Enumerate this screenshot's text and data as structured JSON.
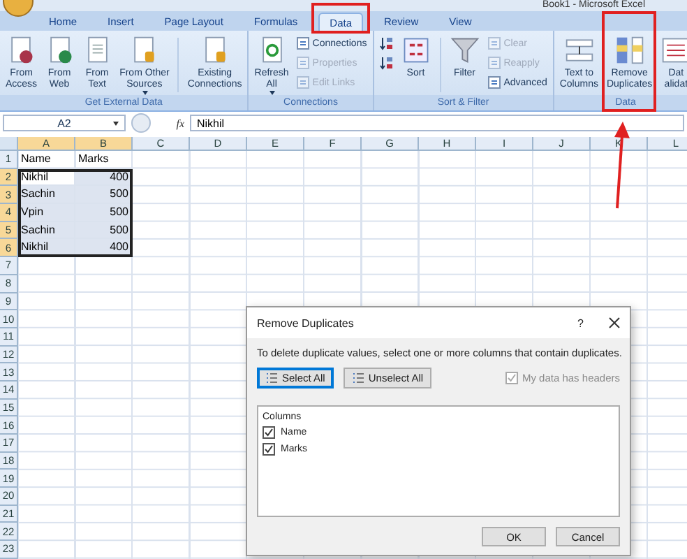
{
  "title": "Book1 - Microsoft Excel",
  "tabs": [
    {
      "label": "Home",
      "selected": false,
      "highlighted": false
    },
    {
      "label": "Insert",
      "selected": false,
      "highlighted": false
    },
    {
      "label": "Page Layout",
      "selected": false,
      "highlighted": false
    },
    {
      "label": "Formulas",
      "selected": false,
      "highlighted": false
    },
    {
      "label": "Data",
      "selected": true,
      "highlighted": true
    },
    {
      "label": "Review",
      "selected": false,
      "highlighted": false
    },
    {
      "label": "View",
      "selected": false,
      "highlighted": false
    }
  ],
  "ribbon_groups": [
    {
      "label": "Get External Data",
      "items": [
        {
          "kind": "large",
          "label": "From\nAccess",
          "dropdown": false,
          "highlighted": false
        },
        {
          "kind": "large",
          "label": "From\nWeb",
          "dropdown": false,
          "highlighted": false
        },
        {
          "kind": "large",
          "label": "From\nText",
          "dropdown": false,
          "highlighted": false
        },
        {
          "kind": "large",
          "label": "From Other\nSources",
          "dropdown": true,
          "highlighted": false
        },
        {
          "kind": "separator"
        },
        {
          "kind": "large",
          "label": "Existing\nConnections",
          "dropdown": false,
          "highlighted": false
        }
      ]
    },
    {
      "label": "Connections",
      "items": [
        {
          "kind": "large",
          "label": "Refresh\nAll",
          "dropdown": true,
          "highlighted": false
        },
        {
          "kind": "stack",
          "items": [
            {
              "kind": "small",
              "label": "Connections",
              "disabled": false
            },
            {
              "kind": "small",
              "label": "Properties",
              "disabled": true
            },
            {
              "kind": "small",
              "label": "Edit Links",
              "disabled": true
            }
          ]
        }
      ]
    },
    {
      "label": "Sort & Filter",
      "items": [
        {
          "kind": "stack",
          "items": [
            {
              "kind": "icon",
              "disabled": false
            },
            {
              "kind": "icon",
              "disabled": false
            }
          ]
        },
        {
          "kind": "large",
          "label": "Sort",
          "dropdown": false,
          "highlighted": false
        },
        {
          "kind": "separator"
        },
        {
          "kind": "large",
          "label": "Filter",
          "dropdown": false,
          "highlighted": false
        },
        {
          "kind": "stack",
          "items": [
            {
              "kind": "small",
              "label": "Clear",
              "disabled": true
            },
            {
              "kind": "small",
              "label": "Reapply",
              "disabled": true
            },
            {
              "kind": "small",
              "label": "Advanced",
              "disabled": false
            }
          ]
        }
      ]
    },
    {
      "label": "Data",
      "items": [
        {
          "kind": "large",
          "label": "Text to\nColumns",
          "dropdown": false,
          "highlighted": false
        },
        {
          "kind": "large",
          "label": "Remove\nDuplicates",
          "dropdown": false,
          "highlighted": true
        },
        {
          "kind": "large",
          "label": "Dat\nalidat",
          "dropdown": false,
          "highlighted": false
        }
      ]
    }
  ],
  "formula_bar": {
    "name_box": "A2",
    "function_label": "fx",
    "value": "Nikhil"
  },
  "columns": [
    {
      "label": "A",
      "selected": true
    },
    {
      "label": "B",
      "selected": true
    },
    {
      "label": "C",
      "selected": false
    },
    {
      "label": "D",
      "selected": false
    },
    {
      "label": "E",
      "selected": false
    },
    {
      "label": "F",
      "selected": false
    },
    {
      "label": "G",
      "selected": false
    },
    {
      "label": "H",
      "selected": false
    },
    {
      "label": "I",
      "selected": false
    },
    {
      "label": "J",
      "selected": false
    },
    {
      "label": "K",
      "selected": false
    },
    {
      "label": "L",
      "selected": false
    }
  ],
  "rows": [
    {
      "number": "1",
      "selected": false,
      "cells": [
        {
          "text": "Name",
          "kind": "text",
          "selected": false
        },
        {
          "text": "Marks",
          "kind": "text",
          "selected": false
        }
      ]
    },
    {
      "number": "2",
      "selected": true,
      "cells": [
        {
          "text": "Nikhil",
          "kind": "text",
          "selected": true
        },
        {
          "text": "400",
          "kind": "number",
          "selected": true
        }
      ]
    },
    {
      "number": "3",
      "selected": true,
      "cells": [
        {
          "text": "Sachin",
          "kind": "text",
          "selected": true
        },
        {
          "text": "500",
          "kind": "number",
          "selected": true
        }
      ]
    },
    {
      "number": "4",
      "selected": true,
      "cells": [
        {
          "text": "Vpin",
          "kind": "text",
          "selected": true
        },
        {
          "text": "500",
          "kind": "number",
          "selected": true
        }
      ]
    },
    {
      "number": "5",
      "selected": true,
      "cells": [
        {
          "text": "Sachin",
          "kind": "text",
          "selected": true
        },
        {
          "text": "500",
          "kind": "number",
          "selected": true
        }
      ]
    },
    {
      "number": "6",
      "selected": true,
      "cells": [
        {
          "text": "Nikhil",
          "kind": "text",
          "selected": true
        },
        {
          "text": "400",
          "kind": "number",
          "selected": true
        }
      ]
    },
    {
      "number": "7",
      "selected": false
    },
    {
      "number": "8",
      "selected": false
    },
    {
      "number": "9",
      "selected": false
    },
    {
      "number": "10",
      "selected": false
    },
    {
      "number": "11",
      "selected": false
    },
    {
      "number": "12",
      "selected": false
    },
    {
      "number": "13",
      "selected": false
    },
    {
      "number": "14",
      "selected": false
    },
    {
      "number": "15",
      "selected": false
    },
    {
      "number": "16",
      "selected": false
    },
    {
      "number": "17",
      "selected": false
    },
    {
      "number": "18",
      "selected": false
    },
    {
      "number": "19",
      "selected": false
    },
    {
      "number": "20",
      "selected": false
    },
    {
      "number": "21",
      "selected": false
    },
    {
      "number": "22",
      "selected": false
    },
    {
      "number": "23",
      "selected": false
    }
  ],
  "dialog": {
    "title": "Remove Duplicates",
    "help": "?",
    "description": "To delete duplicate values, select one or more columns that contain duplicates.",
    "buttons": [
      {
        "label": "Select All",
        "focused": true
      },
      {
        "label": "Unselect All",
        "focused": false
      }
    ],
    "headers_checkbox": {
      "label": "My data has headers",
      "checked": true,
      "disabled": true
    },
    "list_label": "Columns",
    "columns": [
      {
        "label": "Name",
        "checked": true
      },
      {
        "label": "Marks",
        "checked": true
      }
    ],
    "footer_buttons": [
      "OK",
      "Cancel"
    ]
  }
}
